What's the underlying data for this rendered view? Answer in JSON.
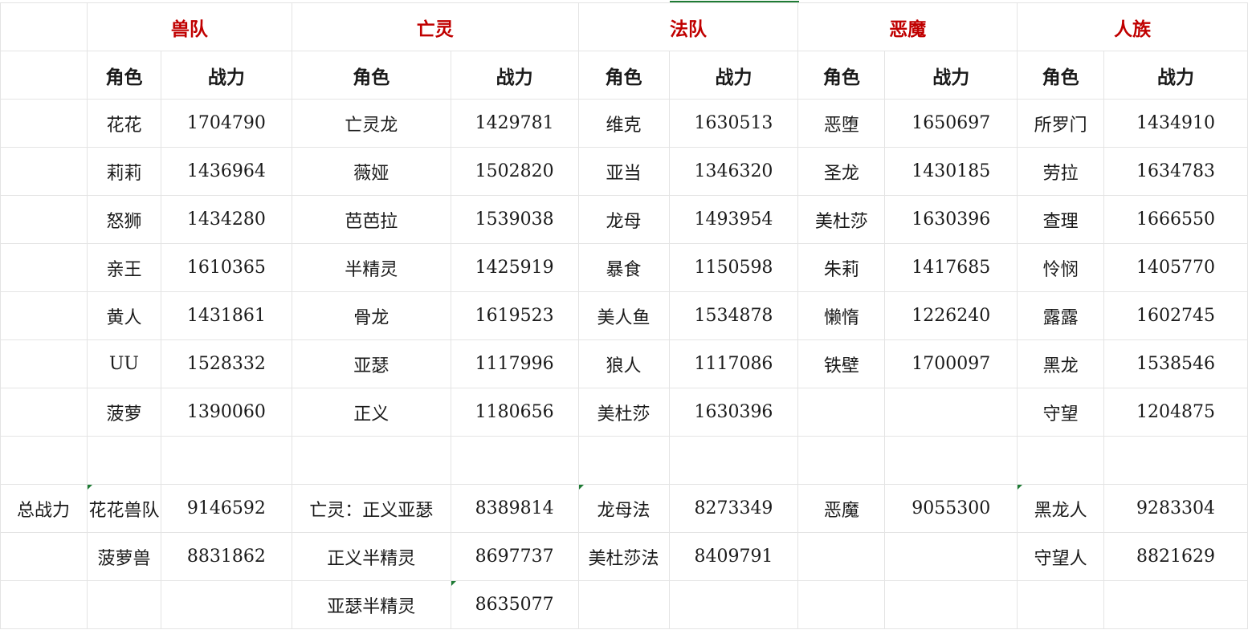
{
  "teams": [
    "兽队",
    "亡灵",
    "法队",
    "恶魔",
    "人族"
  ],
  "col_headers": {
    "role": "角色",
    "power": "战力"
  },
  "rows": [
    [
      "花花",
      "1704790",
      "亡灵龙",
      "1429781",
      "维克",
      "1630513",
      "恶堕",
      "1650697",
      "所罗门",
      "1434910"
    ],
    [
      "莉莉",
      "1436964",
      "薇娅",
      "1502820",
      "亚当",
      "1346320",
      "圣龙",
      "1430185",
      "劳拉",
      "1634783"
    ],
    [
      "怒狮",
      "1434280",
      "芭芭拉",
      "1539038",
      "龙母",
      "1493954",
      "美杜莎",
      "1630396",
      "查理",
      "1666550"
    ],
    [
      "亲王",
      "1610365",
      "半精灵",
      "1425919",
      "暴食",
      "1150598",
      "朱莉",
      "1417685",
      "怜悯",
      "1405770"
    ],
    [
      "黄人",
      "1431861",
      "骨龙",
      "1619523",
      "美人鱼",
      "1534878",
      "懒惰",
      "1226240",
      "露露",
      "1602745"
    ],
    [
      "UU",
      "1528332",
      "亚瑟",
      "1117996",
      "狼人",
      "1117086",
      "铁壁",
      "1700097",
      "黑龙",
      "1538546"
    ],
    [
      "菠萝",
      "1390060",
      "正义",
      "1180656",
      "美杜莎",
      "1630396",
      "",
      "",
      "守望",
      "1204875"
    ]
  ],
  "total_label": "总战力",
  "totals": [
    [
      "花花兽队",
      "9146592",
      "亡灵：正义亚瑟",
      "8389814",
      "龙母法",
      "8273349",
      "恶魔",
      "9055300",
      "黑龙人",
      "9283304"
    ],
    [
      "菠萝兽",
      "8831862",
      "正义半精灵",
      "8697737",
      "美杜莎法",
      "8409791",
      "",
      "",
      "守望人",
      "8821629"
    ],
    [
      "",
      "",
      "亚瑟半精灵",
      "8635077",
      "",
      "",
      "",
      "",
      "",
      ""
    ]
  ]
}
